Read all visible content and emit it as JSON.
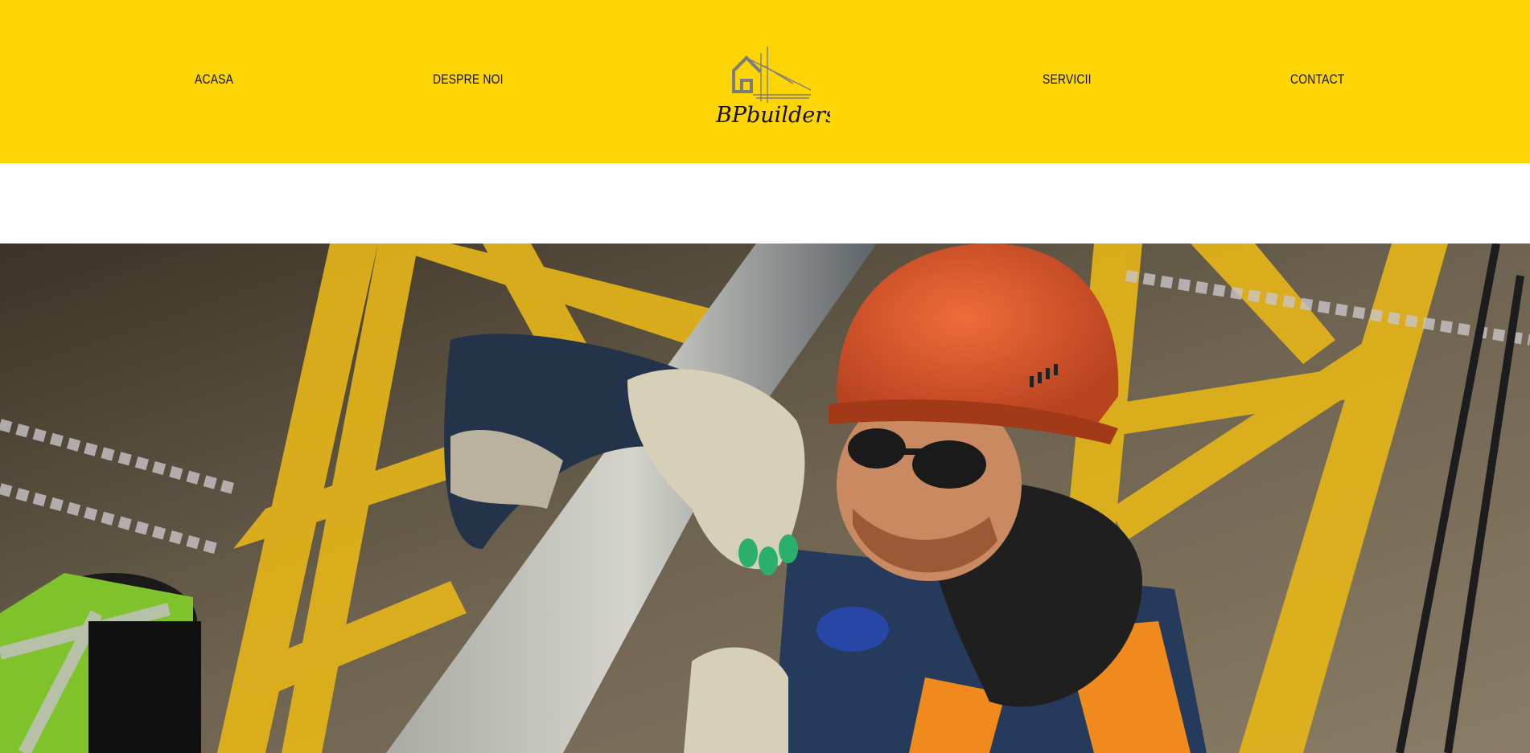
{
  "header": {
    "background": "#FDD404",
    "nav_left": [
      {
        "label": "ACASA"
      },
      {
        "label": "DESPRE NOI"
      }
    ],
    "nav_right": [
      {
        "label": "SERVICII"
      },
      {
        "label": "CONTACT"
      }
    ],
    "logo": {
      "text": "BPbuilders",
      "icon": "house-blueprint-logo-icon"
    }
  },
  "hero": {
    "image": "construction-worker-photo",
    "colors": {
      "frame": "#E3B419",
      "helmet": "#D9542A",
      "vest": "#F08A1C"
    }
  }
}
